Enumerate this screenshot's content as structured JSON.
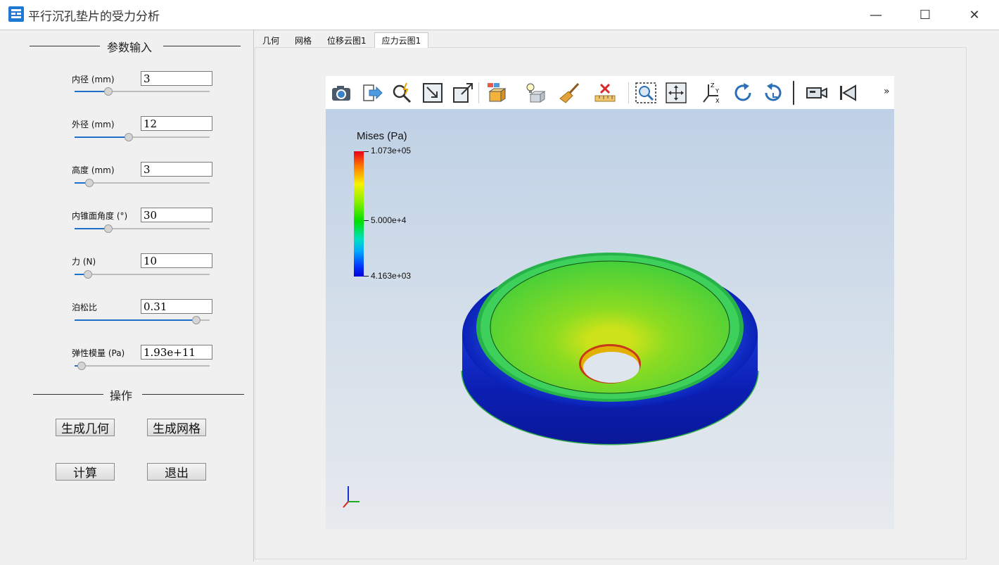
{
  "window": {
    "title": "平行沉孔垫片的受力分析",
    "minimize": "—",
    "maximize": "☐",
    "close": "✕"
  },
  "params": {
    "section_title": "参数输入",
    "fields": [
      {
        "label": "内径 (mm)",
        "value": "3",
        "slider_fraction": 0.25
      },
      {
        "label": "外径 (mm)",
        "value": "12",
        "slider_fraction": 0.4
      },
      {
        "label": "高度 (mm)",
        "value": "3",
        "slider_fraction": 0.11
      },
      {
        "label": "内锥面角度 (°)",
        "value": "30",
        "slider_fraction": 0.25
      },
      {
        "label": "力 (N)",
        "value": "10",
        "slider_fraction": 0.1
      },
      {
        "label": "泊松比",
        "value": "0.31",
        "slider_fraction": 0.9
      },
      {
        "label": "弹性模量 (Pa)",
        "value": "1.93e+11",
        "slider_fraction": 0.05
      }
    ]
  },
  "actions": {
    "section_title": "操作",
    "generate_geometry": "生成几何",
    "generate_mesh": "生成网格",
    "compute": "计算",
    "exit": "退出"
  },
  "tabs": [
    {
      "label": "几何",
      "active": false
    },
    {
      "label": "网格",
      "active": false
    },
    {
      "label": "位移云图1",
      "active": false
    },
    {
      "label": "应力云图1",
      "active": true
    }
  ],
  "toolbar": {
    "icons": [
      "camera-icon",
      "export-icon",
      "query-icon",
      "fit-view-icon",
      "zoom-box-icon",
      "display-mode-icon",
      "light-icon",
      "clean-icon",
      "measure-icon",
      "zoom-select-icon",
      "pan-icon",
      "axes-icon",
      "rotate-cw-icon",
      "rotate-ccw-icon",
      "camera-record-icon",
      "first-frame-icon"
    ],
    "more": "»"
  },
  "colorbar": {
    "title": "Mises (Pa)",
    "max_label": "1.073e+05",
    "mid_label": "5.000e+4",
    "min_label": "4.163e+03"
  },
  "colors": {
    "accent": "#1e6fc8",
    "viewport_top": "#bfd1e6",
    "viewport_bottom": "#e7eaef"
  }
}
